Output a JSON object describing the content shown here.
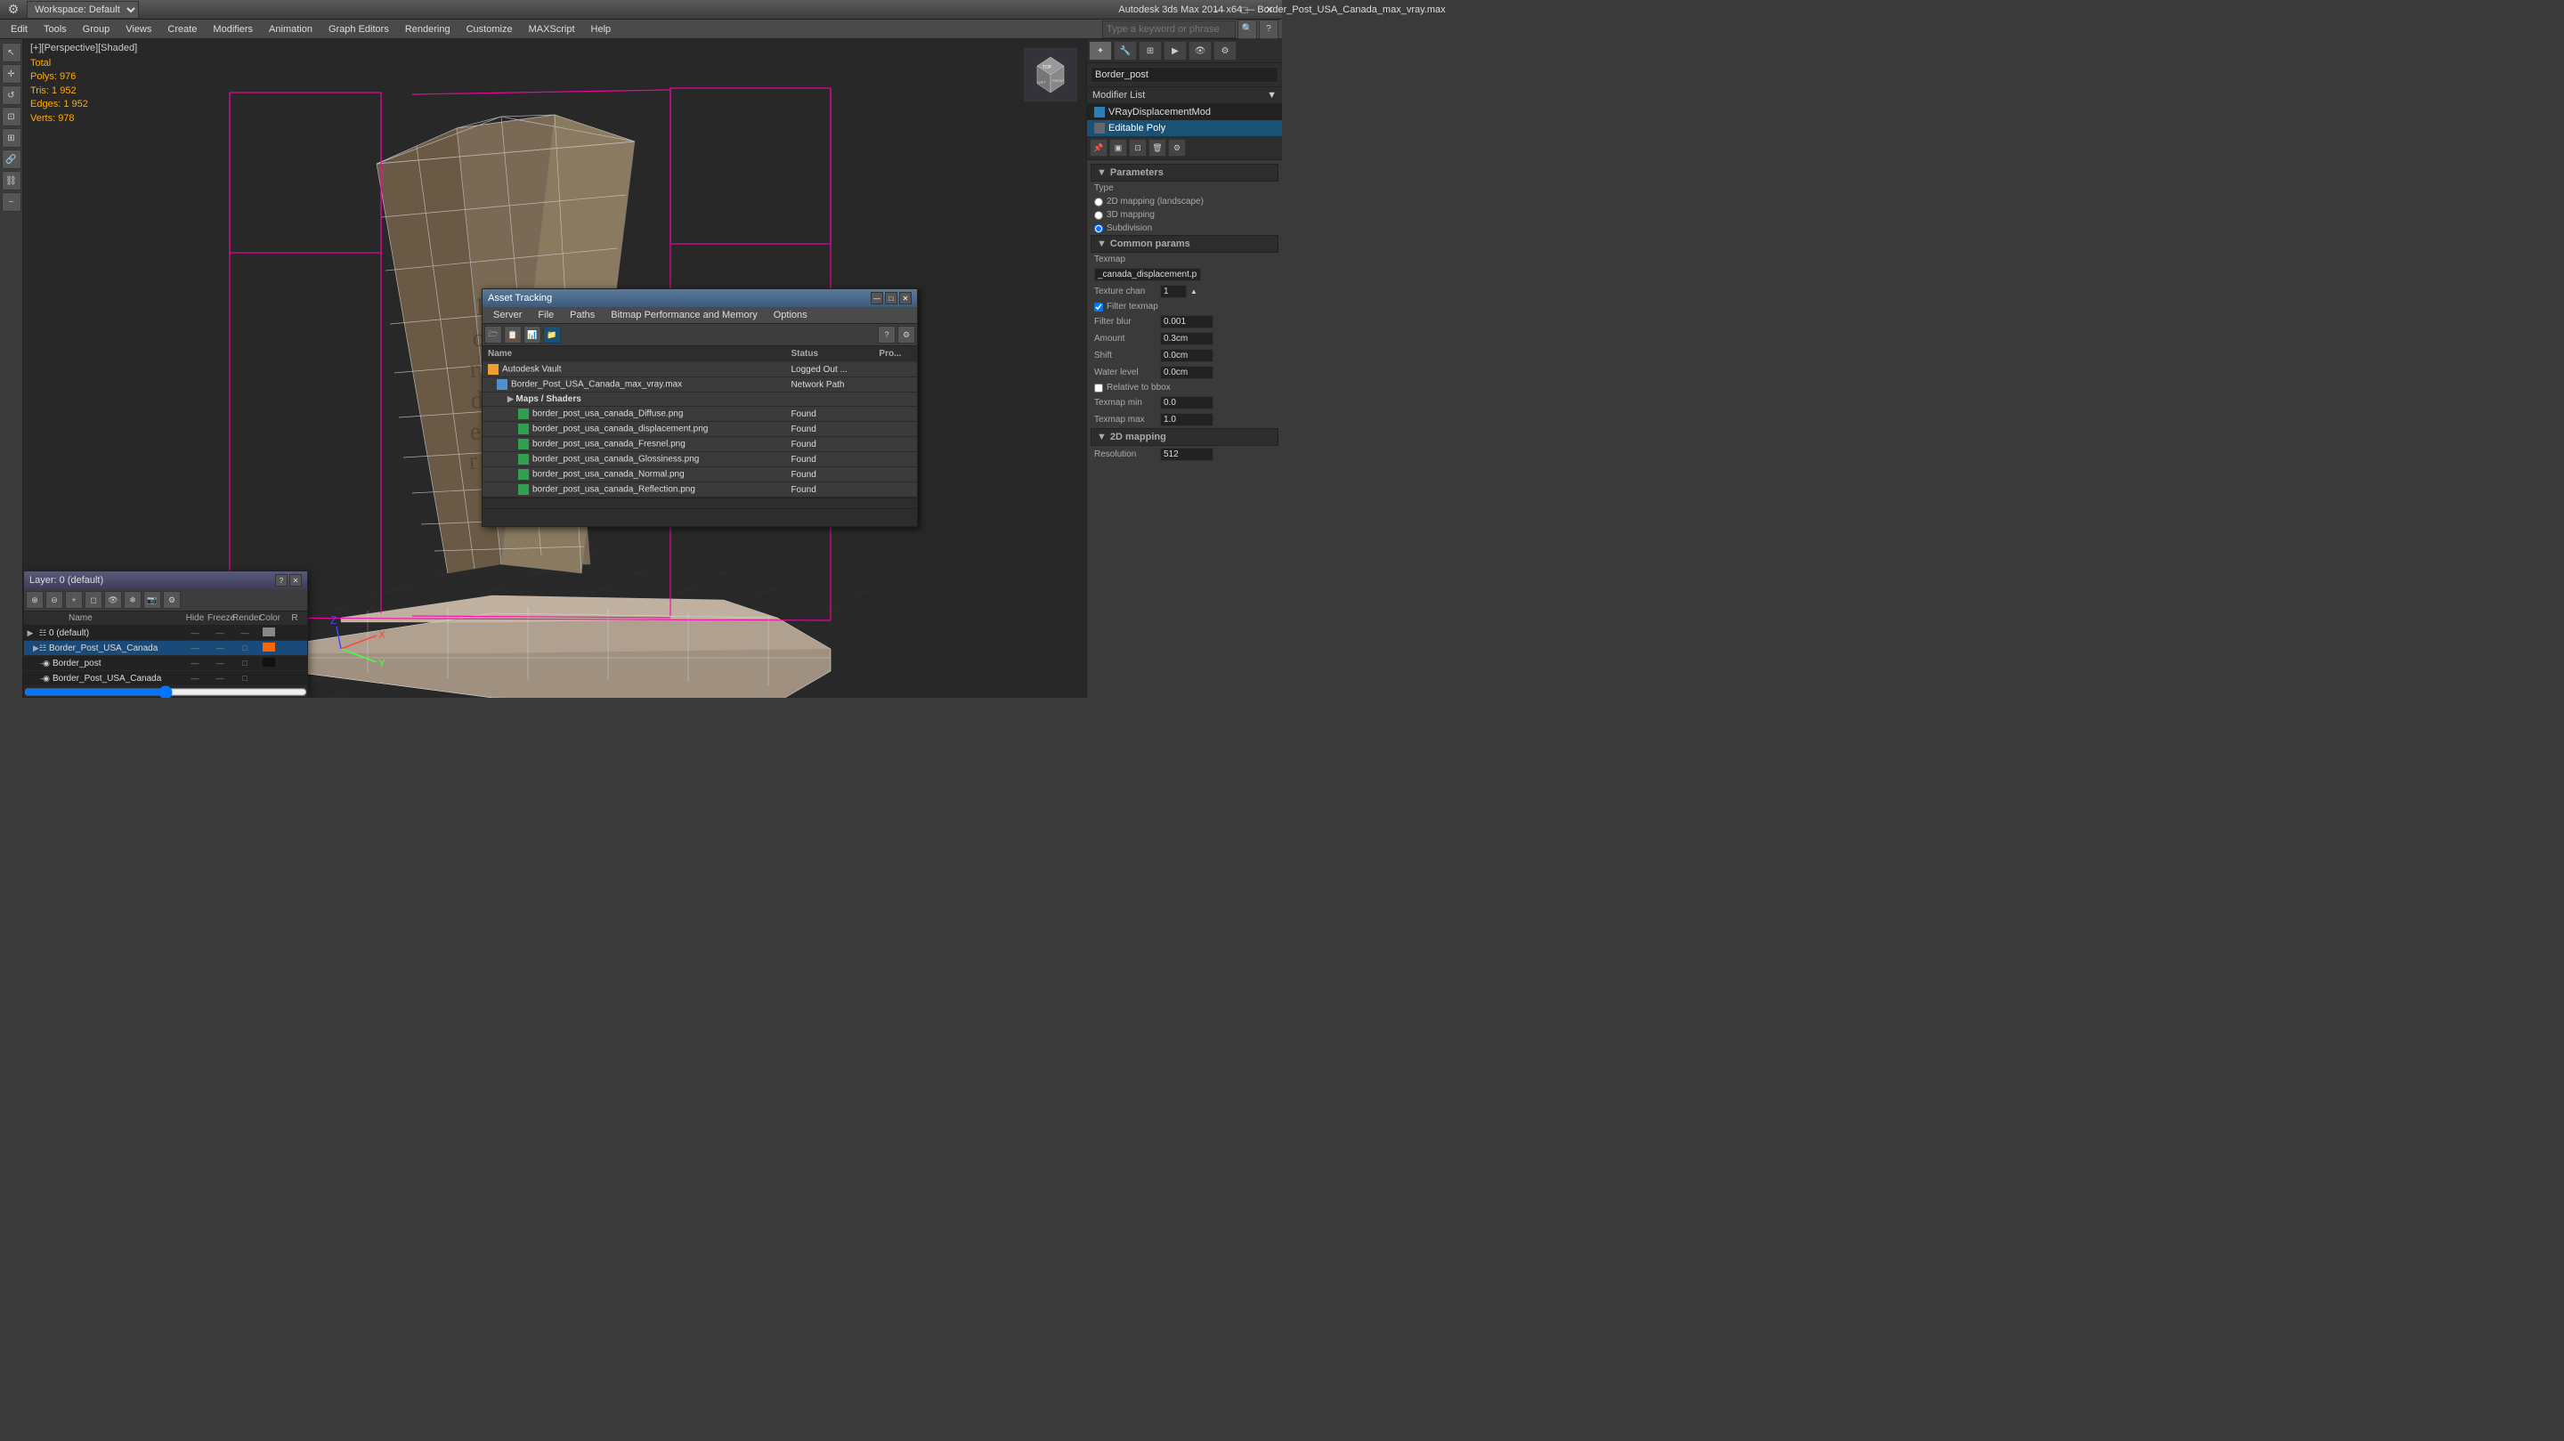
{
  "app": {
    "title": "Autodesk 3ds Max 2014 x64",
    "file": "Border_Post_USA_Canada_max_vray.max",
    "workspace": "Workspace: Default"
  },
  "titlebar": {
    "minimize": "—",
    "maximize": "□",
    "close": "✕"
  },
  "menubar": {
    "items": [
      "Edit",
      "Tools",
      "Group",
      "Views",
      "Create",
      "Modifiers",
      "Animation",
      "Graph Editors",
      "Rendering",
      "Customize",
      "MAXScript",
      "Help"
    ]
  },
  "toolbar": {
    "workspace_label": "Workspace: Default",
    "search_placeholder": "Type a keyword or phrase"
  },
  "viewport": {
    "label": "[+][Perspective][Shaded]",
    "stats": {
      "polys_label": "Polys:",
      "polys_value": "976",
      "tris_label": "Tris:",
      "tris_value": "1 952",
      "edges_label": "Edges:",
      "edges_value": "1 952",
      "verts_label": "Verts:",
      "verts_value": "978",
      "total_label": "Total"
    }
  },
  "right_panel": {
    "object_name": "Border_post",
    "modifier_label": "Modifier List",
    "modifiers": [
      {
        "name": "VRayDisplacementMod",
        "active": false
      },
      {
        "name": "Editable Poly",
        "active": true
      }
    ],
    "parameters": {
      "section": "Parameters",
      "type_label": "Type",
      "type_2d": "2D mapping (landscape)",
      "type_3d": "3D mapping",
      "type_subdiv": "Subdivision",
      "common_params": "Common params",
      "texmap_label": "Texmap",
      "texmap_value": "_canada_displacement.png",
      "texture_chan_label": "Texture chan",
      "texture_chan_value": "1",
      "filter_texmap_label": "Filter texmap",
      "filter_texmap_checked": true,
      "filter_blur_label": "Filter blur",
      "filter_blur_value": "0.001",
      "amount_label": "Amount",
      "amount_value": "0.3cm",
      "shift_label": "Shift",
      "shift_value": "0.0cm",
      "water_level_label": "Water level",
      "water_level_value": "0.0cm",
      "relative_bbox_label": "Relative to bbox",
      "texmap_min_label": "Texmap min",
      "texmap_min_value": "0.0",
      "texmap_max_label": "Texmap max",
      "texmap_max_value": "1.0",
      "mapping_2d": "2D mapping",
      "resolution_label": "Resolution",
      "resolution_value": "512"
    }
  },
  "asset_tracking": {
    "title": "Asset Tracking",
    "menus": [
      "Server",
      "File",
      "Paths",
      "Bitmap Performance and Memory",
      "Options"
    ],
    "columns": {
      "name": "Name",
      "status": "Status",
      "proxy": "Pro..."
    },
    "rows": [
      {
        "indent": 0,
        "type": "vault",
        "name": "Autodesk Vault",
        "status": "Logged Out ...",
        "proxy": ""
      },
      {
        "indent": 1,
        "type": "file",
        "name": "Border_Post_USA_Canada_max_vray.max",
        "status": "Network Path",
        "proxy": ""
      },
      {
        "indent": 2,
        "type": "folder",
        "name": "Maps / Shaders",
        "status": "",
        "proxy": ""
      },
      {
        "indent": 3,
        "type": "img",
        "name": "border_post_usa_canada_Diffuse.png",
        "status": "Found",
        "proxy": ""
      },
      {
        "indent": 3,
        "type": "img",
        "name": "border_post_usa_canada_displacement.png",
        "status": "Found",
        "proxy": ""
      },
      {
        "indent": 3,
        "type": "img",
        "name": "border_post_usa_canada_Fresnel.png",
        "status": "Found",
        "proxy": ""
      },
      {
        "indent": 3,
        "type": "img",
        "name": "border_post_usa_canada_Glossiness.png",
        "status": "Found",
        "proxy": ""
      },
      {
        "indent": 3,
        "type": "img",
        "name": "border_post_usa_canada_Normal.png",
        "status": "Found",
        "proxy": ""
      },
      {
        "indent": 3,
        "type": "img",
        "name": "border_post_usa_canada_Reflection.png",
        "status": "Found",
        "proxy": ""
      }
    ]
  },
  "layers_panel": {
    "title": "Layer: 0 (default)",
    "columns": {
      "name": "Name",
      "hide": "Hide",
      "freeze": "Freeze",
      "render": "Render",
      "color": "Color",
      "r": "R"
    },
    "layers": [
      {
        "indent": 0,
        "name": "0 (default)",
        "hide": "",
        "freeze": "",
        "render": "",
        "color": "#888888",
        "r": ""
      },
      {
        "indent": 1,
        "name": "Border_Post_USA_Canada",
        "hide": "",
        "freeze": "",
        "render": "",
        "color": "#ff6600",
        "r": "",
        "selected": true
      },
      {
        "indent": 2,
        "name": "Border_post",
        "hide": "",
        "freeze": "",
        "render": "",
        "color": "#111111",
        "r": ""
      },
      {
        "indent": 2,
        "name": "Border_Post_USA_Canada",
        "hide": "",
        "freeze": "",
        "render": "",
        "color": "#222222",
        "r": ""
      }
    ]
  }
}
